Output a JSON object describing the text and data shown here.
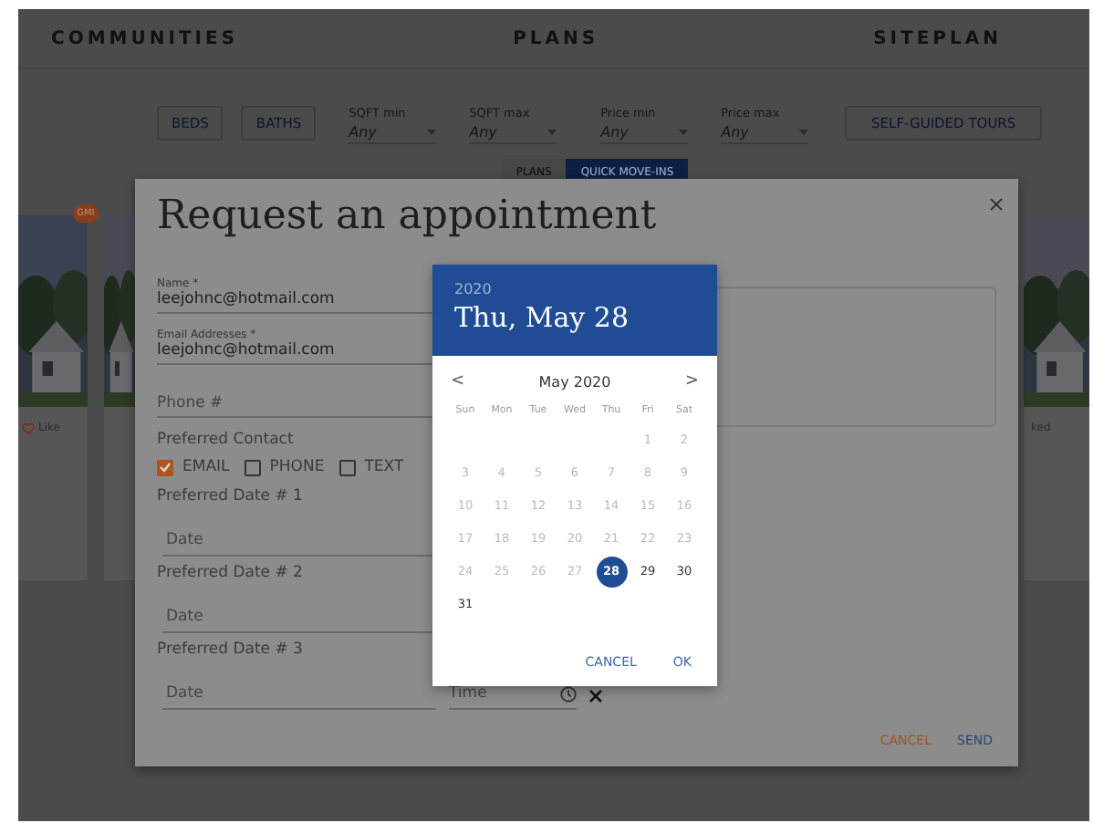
{
  "nav": [
    {
      "label": "COMMUNITIES"
    },
    {
      "label": "PLANS"
    },
    {
      "label": "SITEPLAN"
    }
  ],
  "filters": {
    "buttons": [
      "BEDS",
      "BATHS"
    ],
    "selects": [
      {
        "label": "SQFT min",
        "value": "Any"
      },
      {
        "label": "SQFT max",
        "value": "Any"
      },
      {
        "label": "Price min",
        "value": "Any"
      },
      {
        "label": "Price max",
        "value": "Any"
      }
    ],
    "tours_button": "SELF-GUIDED TOURS"
  },
  "view_toggle": [
    {
      "label": "PLANS",
      "selected": false
    },
    {
      "label": "QUICK MOVE-INS",
      "selected": true
    }
  ],
  "cards_left": {
    "badge": "GMI",
    "like": "Like"
  },
  "cards_right": {
    "status": "ked"
  },
  "dialog": {
    "title": "Request an appointment",
    "name": {
      "label": "Name *",
      "value": "leejohnc@hotmail.com"
    },
    "email": {
      "label": "Email Addresses *",
      "value": "leejohnc@hotmail.com"
    },
    "phone": {
      "placeholder": "Phone #"
    },
    "preferred_contact": {
      "label": "Preferred Contact",
      "options": [
        {
          "label": "EMAIL",
          "checked": true
        },
        {
          "label": "PHONE",
          "checked": false
        },
        {
          "label": "TEXT",
          "checked": false
        }
      ]
    },
    "preferred_dates": [
      {
        "label": "Preferred Date # 1",
        "date_placeholder": "Date"
      },
      {
        "label": "Preferred Date # 2",
        "date_placeholder": "Date"
      },
      {
        "label": "Preferred Date # 3",
        "date_placeholder": "Date",
        "time_placeholder": "Time"
      }
    ],
    "actions": {
      "cancel": "CANCEL",
      "send": "SEND"
    }
  },
  "date_picker": {
    "year": "2020",
    "date": "Thu, May 28",
    "month": "May 2020",
    "prev": "<",
    "next": ">",
    "weekdays": [
      "Sun",
      "Mon",
      "Tue",
      "Wed",
      "Thu",
      "Fri",
      "Sat"
    ],
    "weeks": [
      [
        {
          "day": "1",
          "disabled": true,
          "selected": false
        },
        {
          "day": "2",
          "disabled": true,
          "selected": false
        }
      ],
      [
        {
          "day": "3",
          "disabled": true,
          "selected": false
        },
        {
          "day": "4",
          "disabled": true,
          "selected": false
        },
        {
          "day": "5",
          "disabled": true,
          "selected": false
        },
        {
          "day": "6",
          "disabled": true,
          "selected": false
        },
        {
          "day": "7",
          "disabled": true,
          "selected": false
        },
        {
          "day": "8",
          "disabled": true,
          "selected": false
        },
        {
          "day": "9",
          "disabled": true,
          "selected": false
        }
      ],
      [
        {
          "day": "10",
          "disabled": true,
          "selected": false
        },
        {
          "day": "11",
          "disabled": true,
          "selected": false
        },
        {
          "day": "12",
          "disabled": true,
          "selected": false
        },
        {
          "day": "13",
          "disabled": true,
          "selected": false
        },
        {
          "day": "14",
          "disabled": true,
          "selected": false
        },
        {
          "day": "15",
          "disabled": true,
          "selected": false
        },
        {
          "day": "16",
          "disabled": true,
          "selected": false
        }
      ],
      [
        {
          "day": "17",
          "disabled": true,
          "selected": false
        },
        {
          "day": "18",
          "disabled": true,
          "selected": false
        },
        {
          "day": "19",
          "disabled": true,
          "selected": false
        },
        {
          "day": "20",
          "disabled": true,
          "selected": false
        },
        {
          "day": "21",
          "disabled": true,
          "selected": false
        },
        {
          "day": "22",
          "disabled": true,
          "selected": false
        },
        {
          "day": "23",
          "disabled": true,
          "selected": false
        }
      ],
      [
        {
          "day": "24",
          "disabled": true,
          "selected": false
        },
        {
          "day": "25",
          "disabled": true,
          "selected": false
        },
        {
          "day": "26",
          "disabled": true,
          "selected": false
        },
        {
          "day": "27",
          "disabled": true,
          "selected": false
        },
        {
          "day": "28",
          "disabled": false,
          "selected": true
        },
        {
          "day": "29",
          "disabled": false,
          "selected": false
        },
        {
          "day": "30",
          "disabled": false,
          "selected": false
        }
      ],
      [
        {
          "day": "31",
          "disabled": false,
          "selected": false
        }
      ]
    ],
    "actions": {
      "cancel": "CANCEL",
      "ok": "OK"
    }
  }
}
